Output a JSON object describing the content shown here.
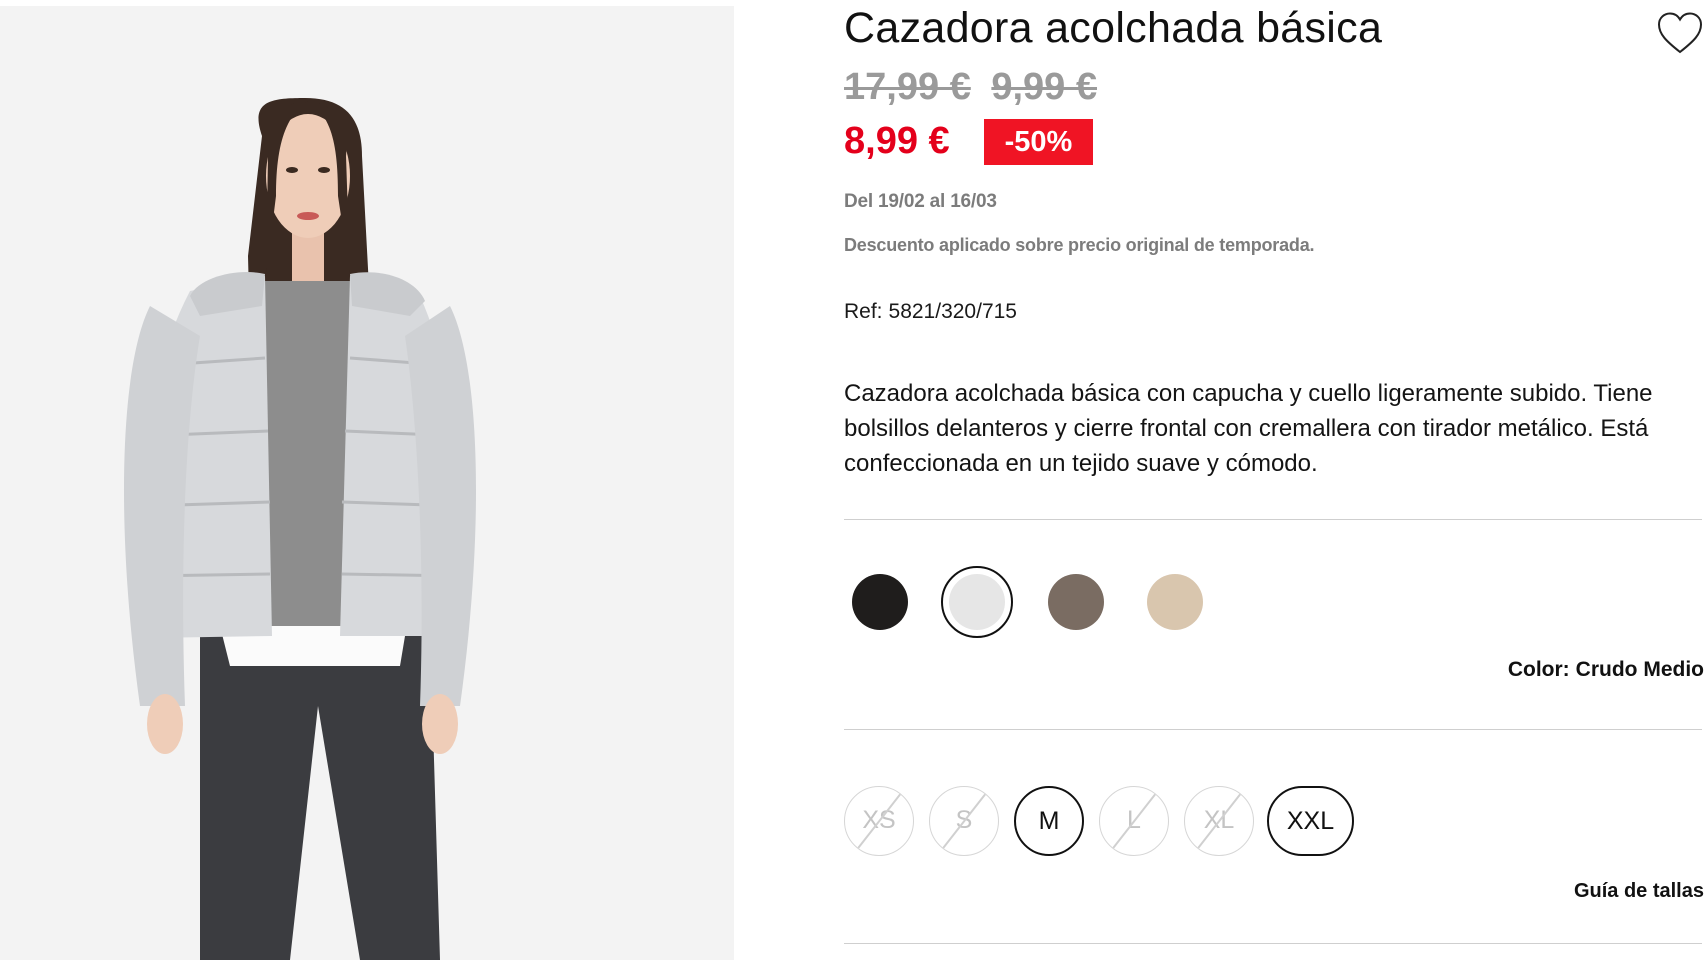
{
  "product": {
    "title": "Cazadora acolchada básica",
    "wishlist_icon": "heart-outline-icon"
  },
  "pricing": {
    "old_prices": [
      "17,99 €",
      "9,99 €"
    ],
    "current_price": "8,99 €",
    "discount_badge": "-50%",
    "promo_dates": "Del 19/02 al 16/03",
    "discount_note": "Descuento aplicado sobre precio original de temporada.",
    "colors": {
      "sale": "#e4001b",
      "badge_bg": "#f01424",
      "muted": "#9a9a9a"
    }
  },
  "reference": {
    "label": "Ref:",
    "value": "5821/320/715"
  },
  "description": "Cazadora acolchada básica con capucha y cuello ligeramente subido. Tiene bolsillos delanteros y cierre frontal con cremallera con tirador metálico. Está confeccionada en un tejido suave y cómodo.",
  "colors": {
    "label": "Color:",
    "selected_name": "Crudo Medio",
    "swatches": [
      {
        "hex": "#1f1d1c",
        "selected": false
      },
      {
        "hex": "#e6e6e6",
        "selected": true
      },
      {
        "hex": "#7a6c62",
        "selected": false
      },
      {
        "hex": "#d9c6ae",
        "selected": false
      }
    ]
  },
  "sizes": {
    "options": [
      {
        "label": "XS",
        "available": false
      },
      {
        "label": "S",
        "available": false
      },
      {
        "label": "M",
        "available": true
      },
      {
        "label": "L",
        "available": false
      },
      {
        "label": "XL",
        "available": false
      },
      {
        "label": "XXL",
        "available": true
      }
    ],
    "guide_label": "Guía de tallas"
  }
}
